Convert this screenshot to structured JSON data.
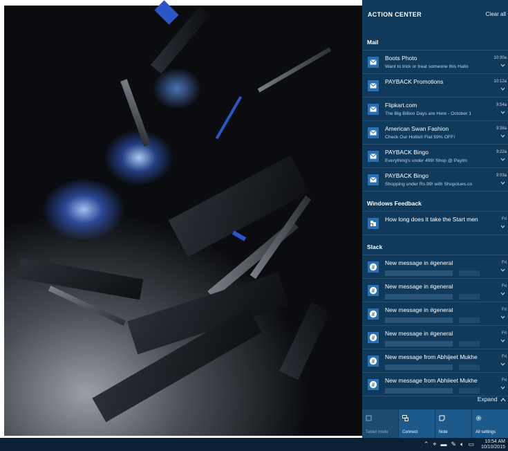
{
  "action_center": {
    "title": "ACTION CENTER",
    "clear_all": "Clear all",
    "expand": "Expand",
    "groups": [
      {
        "name": "Mail",
        "items": [
          {
            "title": "Boots Photo",
            "body": "Want to trick or treat someone this Hallo",
            "time": "10:30a",
            "icon": "mail-icon"
          },
          {
            "title": "PAYBACK Promotions",
            "body": "",
            "time": "10:12a",
            "icon": "mail-icon"
          },
          {
            "title": "Flipkart.com",
            "body": "The Big Billion Days are Here - October 1",
            "time": "9:54a",
            "icon": "mail-icon"
          },
          {
            "title": "American Swan Fashion",
            "body": "Check Our Hotlist! Flat 59% OFF!",
            "time": "9:38a",
            "icon": "mail-icon"
          },
          {
            "title": "PAYBACK Bingo",
            "body": "Everything's under 499! Shop @ Paytm",
            "time": "9:22a",
            "icon": "mail-icon"
          },
          {
            "title": "PAYBACK Bingo",
            "body": "Shopping under Rs.99! with Shopclues.co",
            "time": "9:03a",
            "icon": "mail-icon"
          }
        ]
      },
      {
        "name": "Windows Feedback",
        "items": [
          {
            "title": "How long does it take the Start men",
            "body": "",
            "time": "Fri",
            "icon": "feedback-icon"
          }
        ]
      },
      {
        "name": "Slack",
        "items": [
          {
            "title": "New message in #general",
            "body": "",
            "time": "Fri",
            "icon": "slack-icon"
          },
          {
            "title": "New message in #general",
            "body": "",
            "time": "Fri",
            "icon": "slack-icon"
          },
          {
            "title": "New message in #general",
            "body": "",
            "time": "Fri",
            "icon": "slack-icon"
          },
          {
            "title": "New message in #general",
            "body": "",
            "time": "Fri",
            "icon": "slack-icon"
          },
          {
            "title": "New message from Abhijeet Mukhe",
            "body": "",
            "time": "Fri",
            "icon": "slack-icon"
          },
          {
            "title": "New message from Abhiieet Mukhe",
            "body": "",
            "time": "Fri",
            "icon": "slack-icon"
          }
        ]
      }
    ],
    "quick_actions": [
      {
        "label": "Tablet mode",
        "icon": "tablet-mode-icon",
        "dim": true
      },
      {
        "label": "Connect",
        "icon": "connect-icon",
        "dim": false
      },
      {
        "label": "Note",
        "icon": "note-icon",
        "dim": false
      },
      {
        "label": "All settings",
        "icon": "settings-icon",
        "dim": false
      }
    ]
  },
  "taskbar": {
    "time": "10:54 AM",
    "date": "10/10/2015",
    "tray_icons": [
      "chevron-up-icon",
      "network-icon",
      "battery-icon",
      "pen-icon",
      "volume-icon",
      "notification-icon"
    ]
  },
  "colors": {
    "action_center_bg": "#0f3a5c",
    "tile_bg": "#1d5a8c",
    "taskbar_bg": "#0b2236",
    "accent_icon": "#2b6fb6"
  }
}
